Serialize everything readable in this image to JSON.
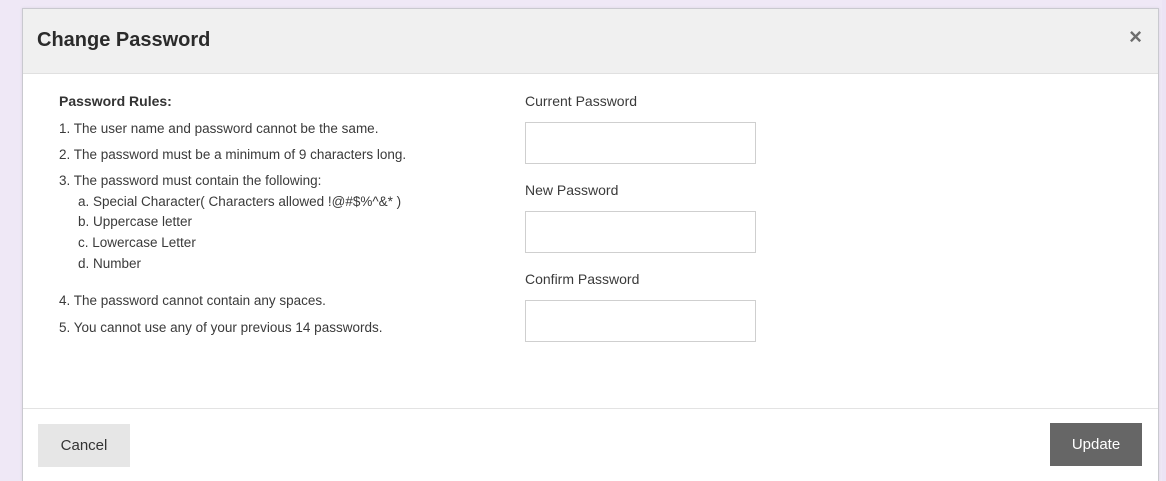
{
  "dialog": {
    "title": "Change Password",
    "close_glyph": "×",
    "close_icon": "close-icon"
  },
  "rules": {
    "heading": "Password Rules:",
    "items": [
      "1. The user name and password cannot be the same.",
      "2. The password must be a minimum of 9 characters long.",
      "3. The password must contain the following:",
      "4. The password cannot contain any spaces.",
      "5. You cannot use any of your previous 14 passwords."
    ],
    "subitems": [
      "a. Special Character( Characters allowed !@#$%^&* )",
      "b. Uppercase letter",
      "c. Lowercase Letter",
      "d. Number"
    ]
  },
  "form": {
    "current_label": "Current Password",
    "current_value": "",
    "new_label": "New Password",
    "new_value": "",
    "confirm_label": "Confirm Password",
    "confirm_value": ""
  },
  "footer": {
    "cancel_label": "Cancel",
    "update_label": "Update"
  },
  "colors": {
    "header_bg": "#f0f0f0",
    "update_bg": "#666666",
    "cancel_bg": "#e6e6e6",
    "backdrop": "#efe8f6"
  }
}
